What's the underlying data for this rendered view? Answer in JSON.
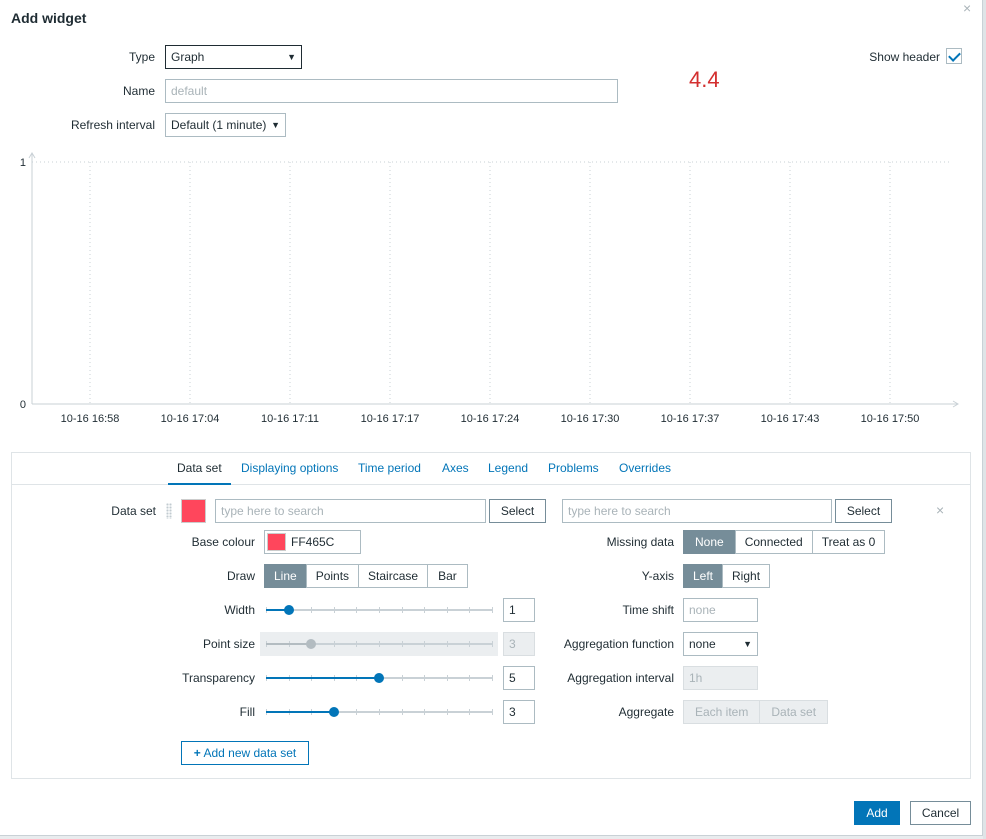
{
  "dialog": {
    "title": "Add widget",
    "close_icon": "×"
  },
  "form": {
    "type_label": "Type",
    "type_value": "Graph",
    "name_label": "Name",
    "name_placeholder": "default",
    "refresh_label": "Refresh interval",
    "refresh_value": "Default (1 minute)",
    "show_header_label": "Show header",
    "show_header_checked": true,
    "big_number": "4.4"
  },
  "chart_data": {
    "type": "line",
    "x": [
      "10-16 16:58",
      "10-16 17:04",
      "10-16 17:11",
      "10-16 17:17",
      "10-16 17:24",
      "10-16 17:30",
      "10-16 17:37",
      "10-16 17:43",
      "10-16 17:50"
    ],
    "y_ticks": [
      "1",
      "0"
    ],
    "ylim": [
      0,
      1
    ],
    "series": [],
    "grid": true
  },
  "tabs": [
    {
      "label": "Data set",
      "active": true
    },
    {
      "label": "Displaying options",
      "active": false
    },
    {
      "label": "Time period",
      "active": false
    },
    {
      "label": "Axes",
      "active": false
    },
    {
      "label": "Legend",
      "active": false
    },
    {
      "label": "Problems",
      "active": false
    },
    {
      "label": "Overrides",
      "active": false
    }
  ],
  "dataset": {
    "label": "Data set",
    "color": "#FF465C",
    "host_placeholder": "type here to search",
    "item_placeholder": "type here to search",
    "select_label": "Select",
    "base_colour_label": "Base colour",
    "base_colour_value": "FF465C",
    "draw_label": "Draw",
    "draw_options": [
      "Line",
      "Points",
      "Staircase",
      "Bar"
    ],
    "draw_selected": "Line",
    "width_label": "Width",
    "width_value": "1",
    "width_fraction": 0.1,
    "point_size_label": "Point size",
    "point_size_value": "3",
    "point_size_fraction": 0.2,
    "transparency_label": "Transparency",
    "transparency_value": "5",
    "transparency_fraction": 0.5,
    "fill_label": "Fill",
    "fill_value": "3",
    "fill_fraction": 0.3,
    "missing_data_label": "Missing data",
    "missing_data_options": [
      "None",
      "Connected",
      "Treat as 0"
    ],
    "missing_data_selected": "None",
    "yaxis_label": "Y-axis",
    "yaxis_options": [
      "Left",
      "Right"
    ],
    "yaxis_selected": "Left",
    "time_shift_label": "Time shift",
    "time_shift_placeholder": "none",
    "agg_function_label": "Aggregation function",
    "agg_function_value": "none",
    "agg_interval_label": "Aggregation interval",
    "agg_interval_placeholder": "1h",
    "aggregate_label": "Aggregate",
    "aggregate_options": [
      "Each item",
      "Data set"
    ],
    "add_new_label": "Add new data set",
    "add_icon": "+"
  },
  "footer": {
    "add_label": "Add",
    "cancel_label": "Cancel"
  },
  "colors": {
    "accent": "#0275b8",
    "series": "#ff465c",
    "big_number": "#d32f2f"
  }
}
